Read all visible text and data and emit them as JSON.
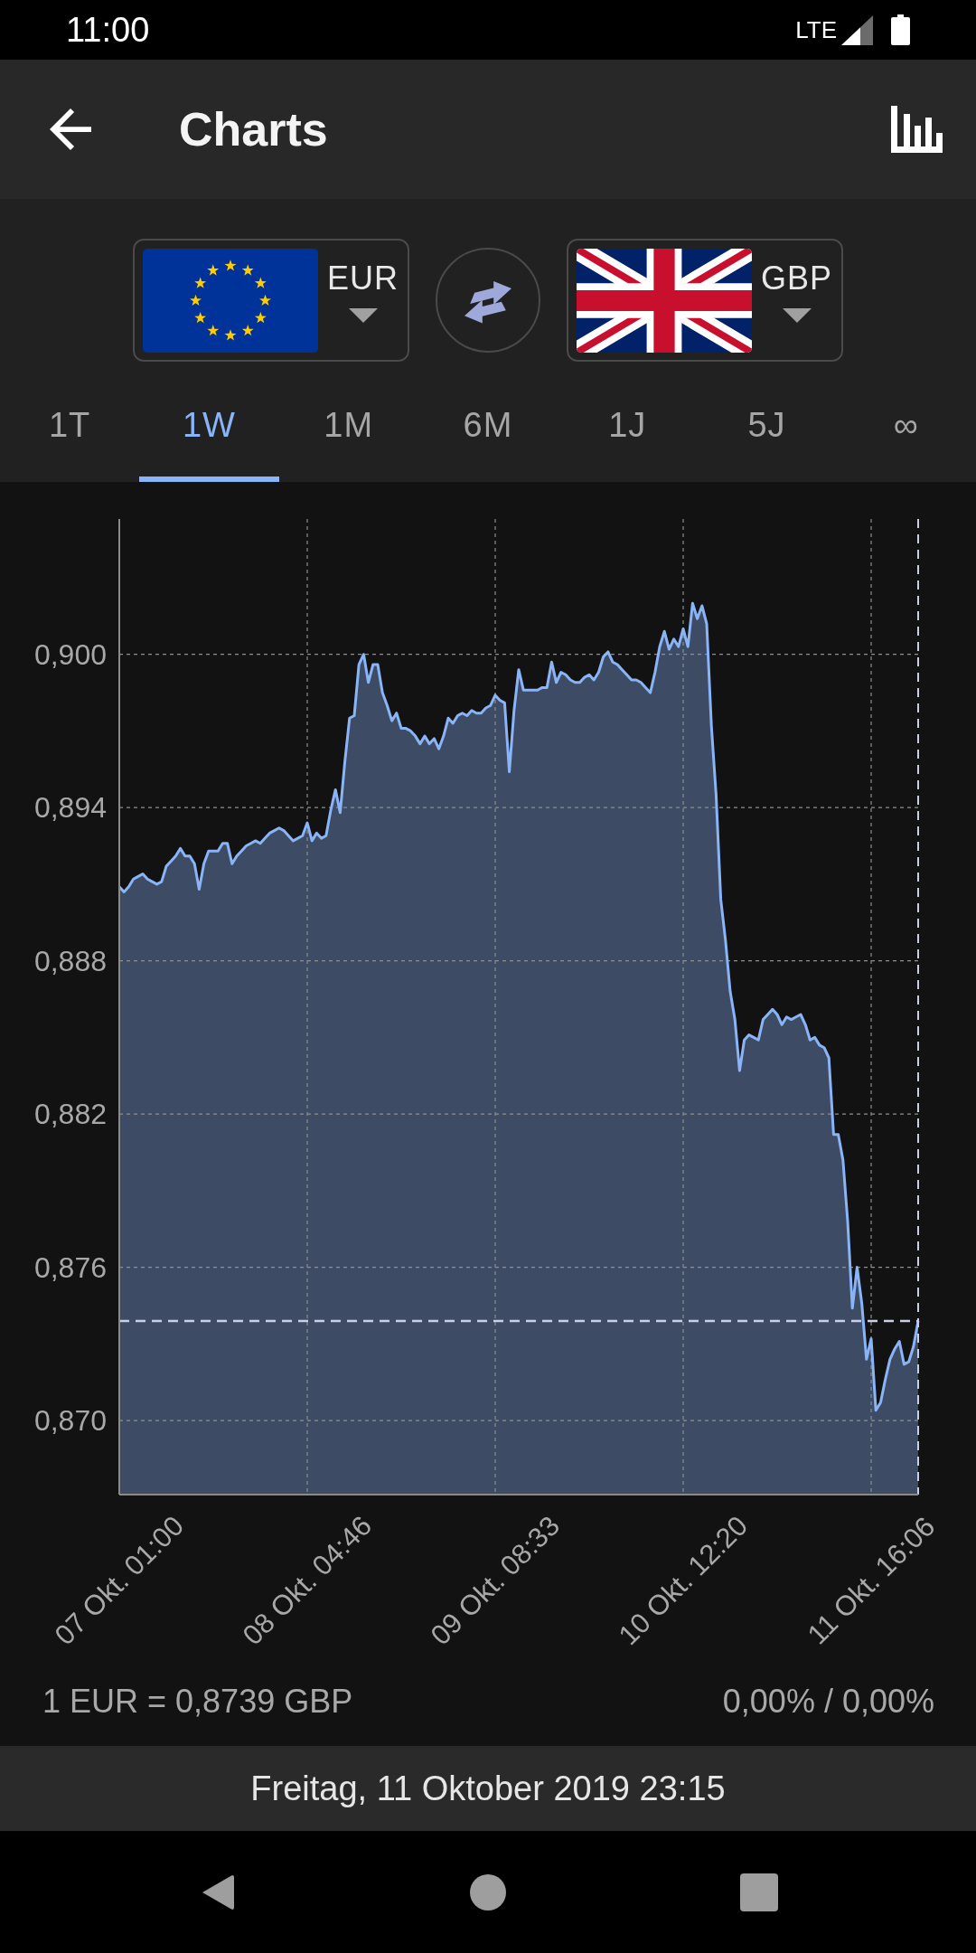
{
  "status_bar": {
    "time": "11:00",
    "network": "LTE"
  },
  "app_bar": {
    "title": "Charts"
  },
  "currencies": [
    {
      "kind": "eu",
      "code": "EUR"
    },
    {
      "kind": "uk",
      "code": "GBP"
    }
  ],
  "periods": [
    {
      "label": "1T",
      "selected": false
    },
    {
      "label": "1W",
      "selected": true
    },
    {
      "label": "1M",
      "selected": false
    },
    {
      "label": "6M",
      "selected": false
    },
    {
      "label": "1J",
      "selected": false
    },
    {
      "label": "5J",
      "selected": false
    },
    {
      "label": "∞",
      "selected": false
    }
  ],
  "chart": {
    "chart_data": {
      "type": "area",
      "grid": true,
      "categories": [
        "07 Okt. 01:00",
        null,
        null,
        null,
        null,
        null,
        null,
        null,
        null,
        null,
        null,
        null,
        null,
        null,
        null,
        null,
        null,
        null,
        null,
        null,
        null,
        null,
        null,
        null,
        null,
        null,
        null,
        null,
        null,
        null,
        null,
        null,
        null,
        null,
        null,
        null,
        null,
        null,
        null,
        null,
        "08 Okt. 04:46",
        null,
        null,
        null,
        null,
        null,
        null,
        null,
        null,
        null,
        null,
        null,
        null,
        null,
        null,
        null,
        null,
        null,
        null,
        null,
        null,
        null,
        null,
        null,
        null,
        null,
        null,
        null,
        null,
        null,
        null,
        null,
        null,
        null,
        null,
        null,
        null,
        null,
        null,
        null,
        "09 Okt. 08:33",
        null,
        null,
        null,
        null,
        null,
        null,
        null,
        null,
        null,
        null,
        null,
        null,
        null,
        null,
        null,
        null,
        null,
        null,
        null,
        null,
        null,
        null,
        null,
        null,
        null,
        null,
        null,
        null,
        null,
        null,
        null,
        null,
        null,
        null,
        null,
        null,
        null,
        null,
        null,
        "10 Okt. 12:20",
        null,
        null,
        null,
        null,
        null,
        null,
        null,
        null,
        null,
        null,
        null,
        null,
        null,
        null,
        null,
        null,
        null,
        null,
        null,
        null,
        null,
        null,
        null,
        null,
        null,
        null,
        null,
        null,
        null,
        null,
        null,
        null,
        null,
        null,
        null,
        null,
        null,
        null,
        null,
        "11 Okt. 16:06",
        null,
        null,
        null,
        null,
        null,
        null,
        null,
        null,
        null,
        null
      ],
      "series": [
        {
          "color": "#8ab4f8",
          "values": [
            0.8909,
            0.8907,
            0.8909,
            0.8912,
            0.8913,
            0.8914,
            0.8912,
            0.8911,
            0.891,
            0.8911,
            0.8917,
            0.8919,
            0.8921,
            0.8924,
            0.8921,
            0.8921,
            0.8918,
            0.8908,
            0.8918,
            0.8923,
            0.8923,
            0.8923,
            0.8926,
            0.8926,
            0.8918,
            0.8921,
            0.8923,
            0.8925,
            0.8926,
            0.8927,
            0.8926,
            0.8928,
            0.893,
            0.8931,
            0.8932,
            0.8931,
            0.8929,
            0.8927,
            0.8928,
            0.8929,
            0.8934,
            0.8927,
            0.893,
            0.8928,
            0.8929,
            0.8939,
            0.8947,
            0.8938,
            0.8958,
            0.8975,
            0.8976,
            0.8996,
            0.9,
            0.8989,
            0.8996,
            0.8996,
            0.8985,
            0.898,
            0.8974,
            0.8977,
            0.8971,
            0.8971,
            0.897,
            0.8968,
            0.8965,
            0.8968,
            0.8965,
            0.8967,
            0.8963,
            0.8968,
            0.8975,
            0.8973,
            0.8976,
            0.8977,
            0.8976,
            0.8978,
            0.8977,
            0.8977,
            0.8979,
            0.898,
            0.8984,
            0.8982,
            0.8981,
            0.8954,
            0.8978,
            0.8994,
            0.8986,
            0.8986,
            0.8986,
            0.8986,
            0.8987,
            0.8987,
            0.8997,
            0.8989,
            0.8993,
            0.8992,
            0.899,
            0.8989,
            0.8989,
            0.8991,
            0.8992,
            0.899,
            0.8993,
            0.8999,
            0.9001,
            0.8997,
            0.8996,
            0.8994,
            0.8992,
            0.899,
            0.899,
            0.8989,
            0.8987,
            0.8985,
            0.8993,
            0.9003,
            0.9009,
            0.9002,
            0.9006,
            0.9003,
            0.901,
            0.9003,
            0.902,
            0.9014,
            0.9019,
            0.9012,
            0.8972,
            0.8945,
            0.8904,
            0.8888,
            0.8868,
            0.8857,
            0.8837,
            0.8849,
            0.8851,
            0.885,
            0.8849,
            0.8857,
            0.8859,
            0.8861,
            0.8859,
            0.8855,
            0.8858,
            0.8857,
            0.8858,
            0.8859,
            0.8855,
            0.8849,
            0.885,
            0.8847,
            0.8846,
            0.8842,
            0.8812,
            0.8812,
            0.8802,
            0.8778,
            0.8744,
            0.876,
            0.8746,
            0.8724,
            0.8732,
            0.8704,
            0.8707,
            0.8716,
            0.8724,
            0.8728,
            0.8731,
            0.8722,
            0.8723,
            0.8729,
            0.8739
          ]
        }
      ],
      "ylim": [
        0.8671,
        0.9053
      ],
      "yticks": [
        {
          "value": 0.87,
          "label": "0,870"
        },
        {
          "value": 0.876,
          "label": "0,876"
        },
        {
          "value": 0.882,
          "label": "0,882"
        },
        {
          "value": 0.888,
          "label": "0,888"
        },
        {
          "value": 0.894,
          "label": "0,894"
        },
        {
          "value": 0.9,
          "label": "0,900"
        }
      ],
      "ref_lines": [
        {
          "axis": "y",
          "value": 0.8739
        }
      ]
    }
  },
  "summary": {
    "rate": "1 EUR = 0,8739 GBP",
    "change": "0,00% / 0,00%"
  },
  "footer": {
    "date": "Freitag, 11 Oktober 2019 23:15"
  }
}
